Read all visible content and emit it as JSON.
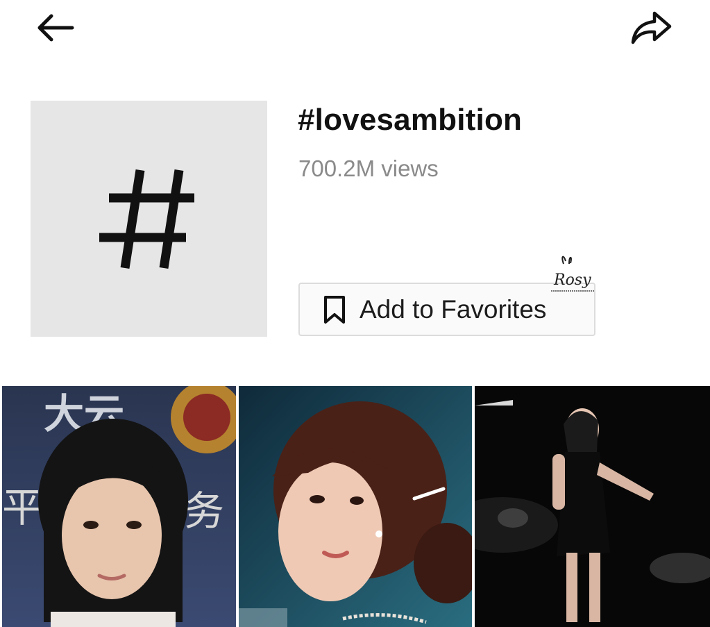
{
  "header": {
    "back_icon": "arrow-left-icon",
    "share_icon": "share-arrow-icon"
  },
  "hashtag": {
    "symbol": "#",
    "title": "#lovesambition",
    "views": "700.2M views"
  },
  "favorites_button": {
    "icon": "bookmark-icon",
    "label": "Add to Favorites"
  },
  "watermark": {
    "text": "Rosy"
  },
  "videos": [
    {
      "kind": "portrait-girl-bangs",
      "overlay_text": "大云"
    },
    {
      "kind": "portrait-girl-side",
      "overlay_text": ""
    },
    {
      "kind": "girl-black-dress-dark",
      "overlay_text": ""
    }
  ]
}
